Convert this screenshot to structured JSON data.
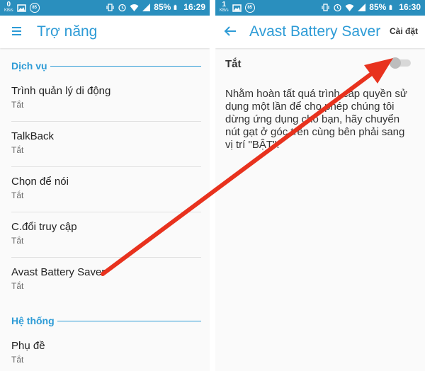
{
  "left": {
    "status": {
      "net_value": "0",
      "net_unit": "KB/s",
      "badge": "85",
      "battery": "85%",
      "time": "16:29"
    },
    "appbar": {
      "title": "Trợ năng",
      "menu_icon": "hamburger-menu-icon"
    },
    "sections": [
      {
        "header": "Dịch vụ",
        "items": [
          {
            "title": "Trình quản lý di động",
            "subtitle": "Tắt"
          },
          {
            "title": "TalkBack",
            "subtitle": "Tắt"
          },
          {
            "title": "Chọn để nói",
            "subtitle": "Tắt"
          },
          {
            "title": "C.đổi truy cập",
            "subtitle": "Tắt"
          },
          {
            "title": "Avast Battery Saver",
            "subtitle": "Tắt"
          }
        ]
      },
      {
        "header": "Hệ thống",
        "items": [
          {
            "title": "Phụ đề",
            "subtitle": "Tắt"
          }
        ]
      }
    ]
  },
  "right": {
    "status": {
      "net_value": "1",
      "net_unit": "KB/s",
      "badge": "85",
      "battery": "85%",
      "time": "16:30"
    },
    "appbar": {
      "title": "Avast Battery Saver",
      "action": "Cài đặt",
      "back_icon": "back-arrow-icon"
    },
    "toggle": {
      "label": "Tắt",
      "state": "off"
    },
    "description": "Nhằm hoàn tất quá trình cấp quyền sử dụng một lần để cho phép chúng tôi dừng ứng dụng cho bạn, hãy chuyển nút gạt ở góc trên cùng bên phải sang vị trí \"BẬT\"."
  },
  "colors": {
    "status_bar": "#2a8fbe",
    "accent": "#2d9bd6",
    "arrow": "#e8321e"
  }
}
